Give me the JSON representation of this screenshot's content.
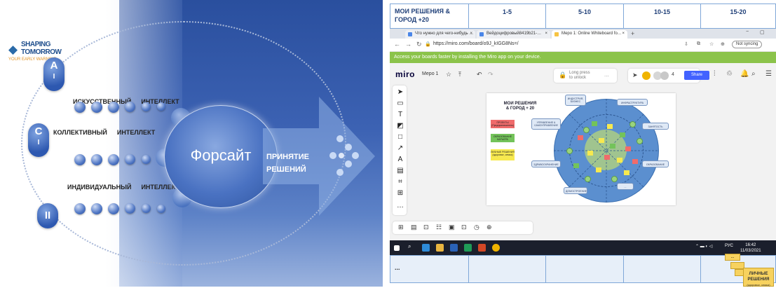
{
  "slide": {
    "logo": {
      "line1": "SHAPING",
      "line2": "TOMORROW",
      "tagline": "YOUR EARLY WARNING"
    },
    "layers": [
      {
        "letter1": "A",
        "letter2": "I",
        "label_word1": "ИСКУССТВЕННЫЙ",
        "label_word2": "ИНТЕЛЛЕКТ"
      },
      {
        "letter1": "C",
        "letter2": "I",
        "label_word1": "КОЛЛЕКТИВНЫЙ",
        "label_word2": "ИНТЕЛЛЕКТ"
      },
      {
        "letter1": "II",
        "letter2": "",
        "label_word1": "ИНДИВИДУАЛЬНЫЙ",
        "label_word2": "ИНТЕЛЛЕКТ"
      }
    ],
    "center": "Форсайт",
    "decision_line1": "ПРИНЯТИЕ",
    "decision_line2": "РЕШЕНИЙ",
    "colors": {
      "slide_blue": "#2a4f9e",
      "bubble_blue": "#2d58b0"
    }
  },
  "table": {
    "headers": [
      "МОИ РЕШЕНИЯ & ГОРОД +20",
      "1-5",
      "5-10",
      "10-15",
      "15-20"
    ],
    "bottom_first": "...",
    "border_color": "#7fa7d8"
  },
  "browser": {
    "tabs": [
      {
        "label": "Что нужно для чего-нибудь …",
        "close": "×"
      },
      {
        "label": "Вейдоцифровый8419b21-…",
        "close": "×"
      },
      {
        "label": "Мерo 1: Online Whiteboard fo…",
        "close": "×"
      }
    ],
    "new_tab": "+",
    "window_min": "−",
    "window_max": "▢",
    "url": "https://miro.com/board/o9J_kIGG8Ns=/",
    "not_syncing": "Not syncing",
    "banner": "Access your boards faster by installing the Miro app on your device."
  },
  "miro": {
    "logo": "miro",
    "board_name": "Мерo 1",
    "lock_line1": "Long press",
    "lock_line2": "to unlock",
    "more": "...",
    "collaborator_count": "4",
    "share": "Share",
    "accent_color": "#4262ff",
    "left_tools": [
      "➤",
      "▭",
      "T",
      "◩",
      "□",
      "↗",
      "A",
      "▤",
      "⌗",
      "⊞",
      "…"
    ],
    "bottom_tools": [
      "⊞",
      "▤",
      "⊡",
      "☷",
      "▣",
      "⊡",
      "◷",
      "⊕"
    ],
    "frame": {
      "title_line1": "МОИ РЕШЕНИЯ",
      "title_line2": "& ГОРОД + 20",
      "stickies": [
        {
          "text": "ПРОЕКТЫ (Предприниматель)",
          "color": "#f06b6b"
        },
        {
          "text": "ОБРАЗОВАНИЕ КАРЬЕРА",
          "color": "#73c35a"
        },
        {
          "text": "ЛИЧНЫЕ РЕШЕНИЯ (здоровье, семья)",
          "color": "#f7e94f"
        }
      ],
      "categories": [
        "ИНДУСТРИЯ, БИЗНЕС",
        "ИНФРАСТРУКТУРА",
        "УПРАВЛЕНИЕ & САМОУПРАВЛЕНИЕ",
        "ЗАНЯТОСТЬ",
        "ЗДРАВООХРАНЕНИЕ",
        "ОБРАЗОВАНИЕ",
        "ДОМОСТРОЕНИЕ",
        "..."
      ]
    }
  },
  "taskbar": {
    "lang": "РУС",
    "time": "16:42",
    "date": "11/03/2021"
  },
  "stack_label_line1": "ЛИЧНЫЕ",
  "stack_label_line2": "РЕШЕНИЯ",
  "stack_label_line3": "(здоровье, семья)",
  "stack_dots": "..."
}
